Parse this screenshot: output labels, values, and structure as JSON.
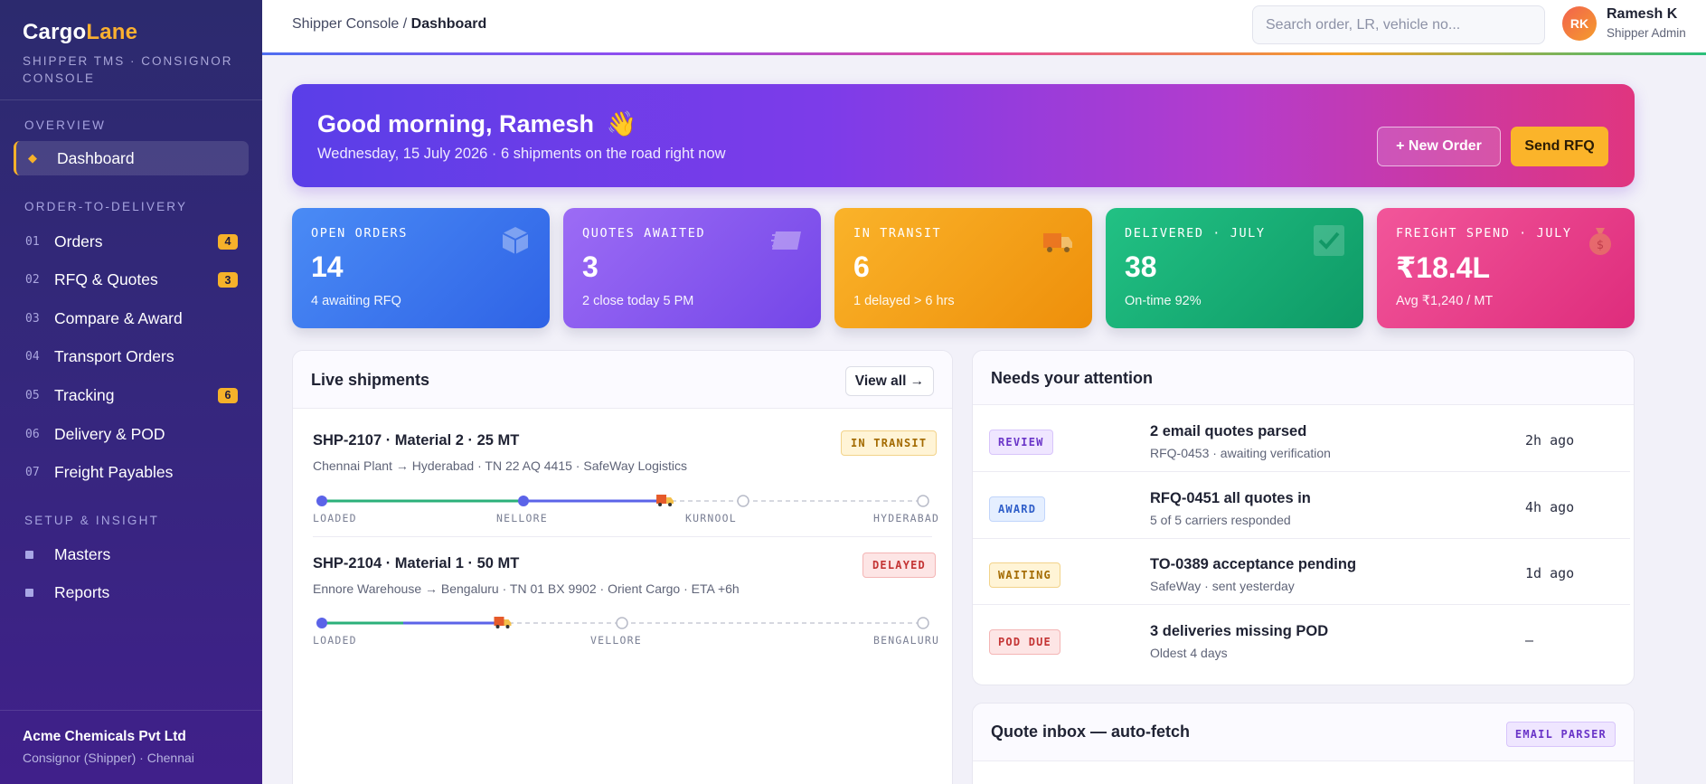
{
  "brand": {
    "name_a": "Cargo",
    "name_b": "Lane",
    "sub": "SHIPPER TMS · CONSIGNOR CONSOLE"
  },
  "sidebar": {
    "section_overview": "OVERVIEW",
    "dashboard": "Dashboard",
    "section_otd": "ORDER-TO-DELIVERY",
    "items": [
      {
        "num": "01",
        "label": "Orders",
        "count": "4"
      },
      {
        "num": "02",
        "label": "RFQ & Quotes",
        "count": "3"
      },
      {
        "num": "03",
        "label": "Compare & Award",
        "count": ""
      },
      {
        "num": "04",
        "label": "Transport Orders",
        "count": ""
      },
      {
        "num": "05",
        "label": "Tracking",
        "count": "6"
      },
      {
        "num": "06",
        "label": "Delivery & POD",
        "count": ""
      },
      {
        "num": "07",
        "label": "Freight Payables",
        "count": ""
      }
    ],
    "section_setup": "SETUP & INSIGHT",
    "setup_items": [
      {
        "label": "Masters"
      },
      {
        "label": "Reports"
      }
    ],
    "company_name": "Acme Chemicals Pvt Ltd",
    "company_sub": "Consignor (Shipper) · Chennai"
  },
  "header": {
    "crumb_root": "Shipper Console",
    "crumb_sep": " / ",
    "crumb_current": "Dashboard",
    "search_placeholder": "Search order, LR, vehicle no...",
    "avatar_initials": "RK",
    "user_name": "Ramesh K",
    "user_role": "Shipper Admin"
  },
  "hero": {
    "greeting": "Good morning, Ramesh",
    "wave": "👋",
    "subtitle": "Wednesday, 15 July 2026 · 6 shipments on the road right now",
    "new_order": "+ New Order",
    "send_rfq": "Send RFQ"
  },
  "stats": [
    {
      "title": "OPEN ORDERS",
      "value": "14",
      "sub": "4 awaiting RFQ",
      "icon": "box-icon"
    },
    {
      "title": "QUOTES AWAITED",
      "value": "3",
      "sub": "2 close today 5 PM",
      "icon": "quote-icon"
    },
    {
      "title": "IN TRANSIT",
      "value": "6",
      "sub": "1 delayed > 6 hrs",
      "icon": "truck-icon"
    },
    {
      "title": "DELIVERED · JULY",
      "value": "38",
      "sub": "On-time 92%",
      "icon": "check-icon"
    },
    {
      "title": "FREIGHT SPEND · JULY",
      "value": "₹18.4L",
      "sub": "Avg ₹1,240 / MT",
      "icon": "money-bag-icon"
    }
  ],
  "colors": {
    "stat_blue": "#3f7df0",
    "stat_purple": "#8a5cf0",
    "stat_amber": "#f5a21a",
    "stat_green": "#18b07a",
    "stat_pink": "#ec4690",
    "track_green": "#2bb07a",
    "track_blue": "#5b63e8"
  },
  "live": {
    "title": "Live shipments",
    "view_all": "View all →",
    "shipments": [
      {
        "title": "SHP-2107 · Material 2 · 25 MT",
        "route": "Chennai Plant → Hyderabad · TN 22 AQ 4415 · SafeWay Logistics",
        "status": "IN TRANSIT",
        "stops": [
          "LOADED",
          "NELLORE",
          "KURNOOL",
          "HYDERABAD"
        ],
        "progress": 0.57
      },
      {
        "title": "SHP-2104 · Material 1 · 50 MT",
        "route": "Ennore Warehouse → Bengaluru · TN 01 BX 9902 · Orient Cargo · ETA +6h",
        "status": "DELAYED",
        "stops": [
          "LOADED",
          "VELLORE",
          "BENGALURU"
        ],
        "progress": 0.3
      }
    ]
  },
  "attention": {
    "title": "Needs your attention",
    "items": [
      {
        "badge": "REVIEW",
        "title": "2 email quotes parsed",
        "sub": "RFQ-0453 · awaiting verification",
        "time": "2h ago"
      },
      {
        "badge": "AWARD",
        "title": "RFQ-0451 all quotes in",
        "sub": "5 of 5 carriers responded",
        "time": "4h ago"
      },
      {
        "badge": "WAITING",
        "title": "TO-0389 acceptance pending",
        "sub": "SafeWay · sent yesterday",
        "time": "1d ago"
      },
      {
        "badge": "POD DUE",
        "title": "3 deliveries missing POD",
        "sub": "Oldest 4 days",
        "time": "—"
      }
    ]
  },
  "quote_inbox": {
    "title": "Quote inbox — auto-fetch",
    "badge": "EMAIL PARSER"
  }
}
